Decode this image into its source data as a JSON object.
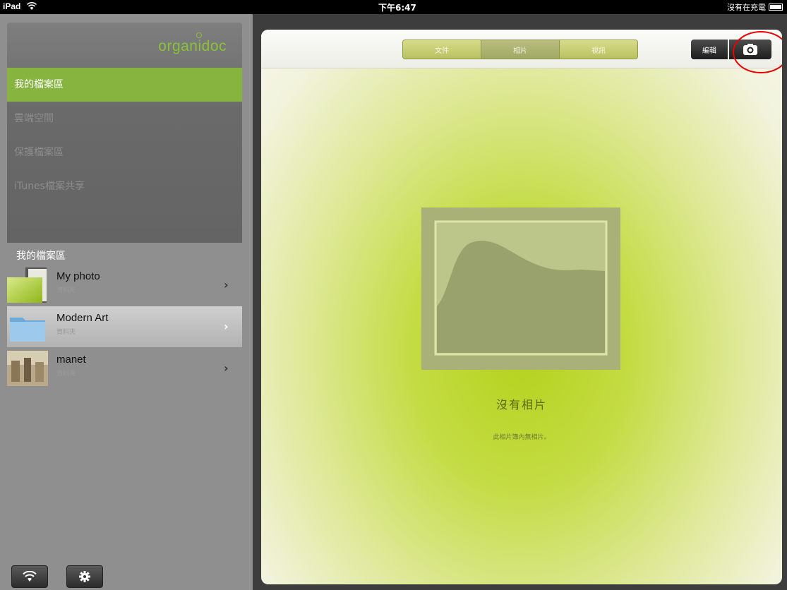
{
  "statusbar": {
    "device": "iPad",
    "time": "下午6:47",
    "charge": "沒有在充電"
  },
  "sidebar": {
    "logo": "organidoc",
    "nav": [
      {
        "label": "我的檔案區"
      },
      {
        "label": "雲端空間"
      },
      {
        "label": "保護檔案區"
      },
      {
        "label": "iTunes檔案共享"
      }
    ],
    "section_title": "我的檔案區",
    "files": [
      {
        "name": "My photo",
        "sub": "資料夾"
      },
      {
        "name": "Modern Art",
        "sub": "資料夾"
      },
      {
        "name": "manet",
        "sub": "資料夾"
      }
    ]
  },
  "toolbar": {
    "tabs": [
      {
        "label": "文件"
      },
      {
        "label": "相片"
      },
      {
        "label": "視訊"
      }
    ],
    "edit_label": "編輯"
  },
  "empty": {
    "title": "沒有相片",
    "subtitle": "此相片簿內無相片。"
  },
  "colors": {
    "accent": "#86b43f",
    "logo": "#8ac238",
    "highlight": "#e00000"
  }
}
